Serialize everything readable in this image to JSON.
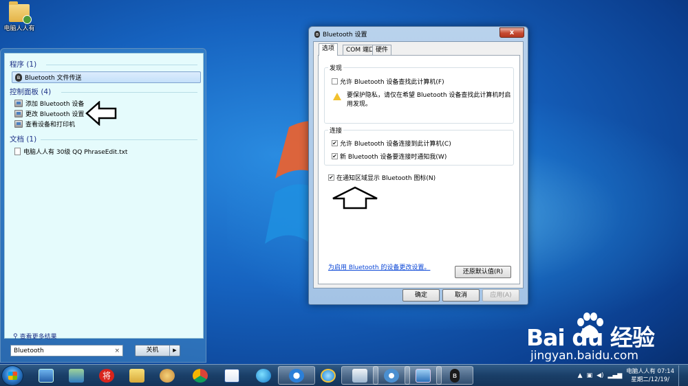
{
  "desktop": {
    "icon_label": "电脑人人有"
  },
  "start_menu": {
    "sections": {
      "programs": "程序 (1)",
      "control_panel": "控制面板 (4)",
      "documents": "文档 (1)"
    },
    "program_items": [
      "Bluetooth 文件传送"
    ],
    "control_panel_items": [
      "添加 Bluetooth 设备",
      "更改 Bluetooth 设置",
      "查看设备和打印机"
    ],
    "document_items": [
      "电脑人人有 30级 QQ  PhraseEdit.txt"
    ],
    "see_more": "查看更多结果",
    "search_value": "Bluetooth",
    "search_clear": "×",
    "shutdown_label": "关机",
    "shutdown_arrow": "▶"
  },
  "dialog": {
    "title": "Bluetooth 设置",
    "close": "x",
    "tabs": [
      "选项",
      "COM 端口",
      "硬件"
    ],
    "discovery_group": "发现",
    "allow_discovery": "允许 Bluetooth 设备查找此计算机(F)",
    "warning_text": "要保护隐私，请仅在希望 Bluetooth 设备查找此计算机时启用发现。",
    "connections_group": "连接",
    "allow_connect": "允许 Bluetooth 设备连接到此计算机(C)",
    "notify_connect": "新 Bluetooth 设备要连接时通知我(W)",
    "show_icon": "在通知区域显示 Bluetooth 图标(N)",
    "link": "为启用 Bluetooth 的设备更改设置。",
    "restore_defaults": "还原默认值(R)",
    "ok": "确定",
    "cancel": "取消",
    "apply": "应用(A)",
    "check_mark": "✔",
    "state": {
      "allow_discovery": false,
      "allow_connect": true,
      "notify_connect": true,
      "show_icon": true
    }
  },
  "watermark": {
    "logo": "Bai du 经验",
    "url": "jingyan.baidu.com"
  },
  "taskbar": {
    "clock_line1": "电脑人人有 07:14",
    "clock_line2": "星期二/12/19/",
    "tray_overflow": "▲",
    "icons": [
      "desktop-icon",
      "control-panel-icon",
      "chess-icon",
      "folder-icon",
      "paint-icon",
      "chrome-icon",
      "word-icon",
      "edge-icon",
      "sogou-icon",
      "ie-icon",
      "explorer-icon",
      "media-icon",
      "computer-icon",
      "bluetooth-icon"
    ],
    "chess_char": "将"
  }
}
